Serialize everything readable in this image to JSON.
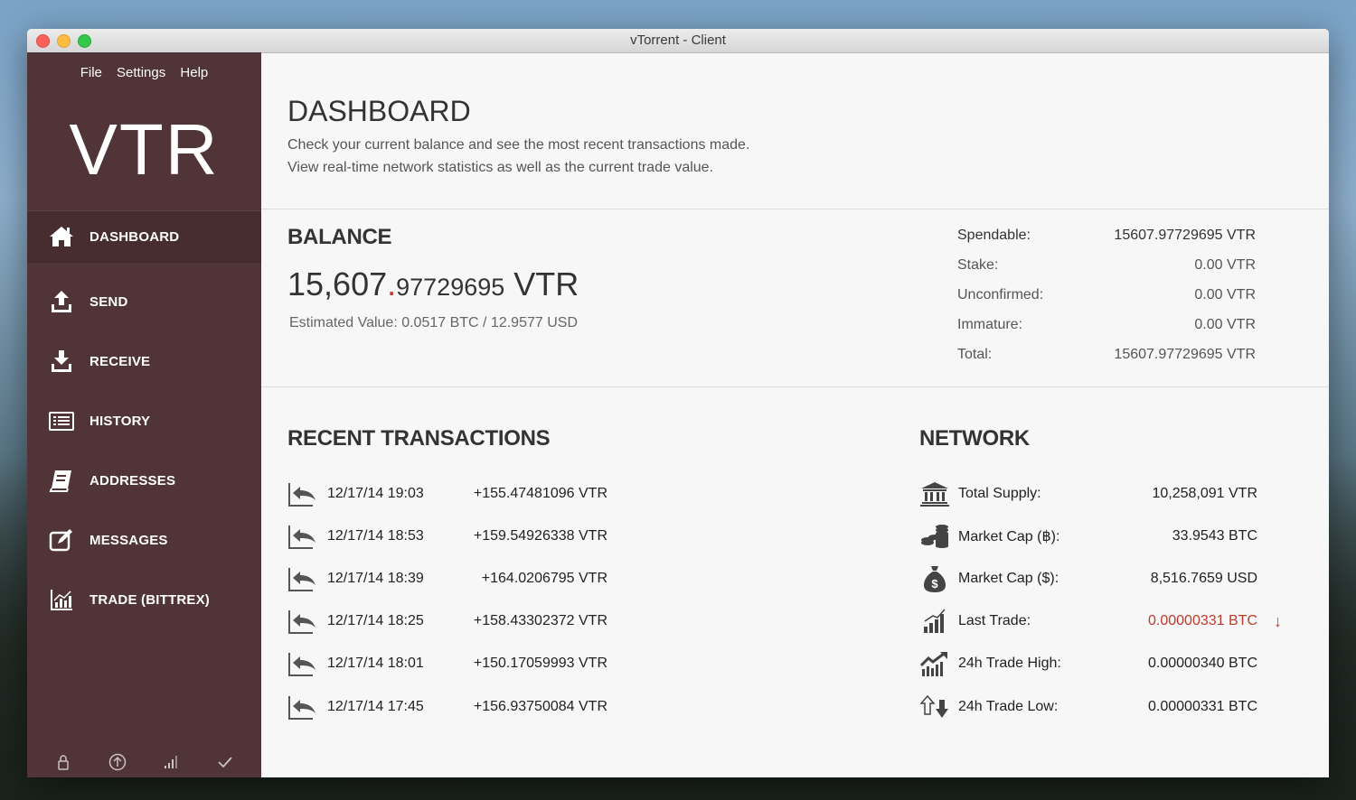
{
  "window": {
    "title": "vTorrent - Client"
  },
  "menu": {
    "file": "File",
    "settings": "Settings",
    "help": "Help"
  },
  "logo": "VTR",
  "nav": [
    {
      "label": "DASHBOARD",
      "icon": "home-icon"
    },
    {
      "label": "SEND",
      "icon": "upload-icon"
    },
    {
      "label": "RECEIVE",
      "icon": "download-icon"
    },
    {
      "label": "HISTORY",
      "icon": "list-icon"
    },
    {
      "label": "ADDRESSES",
      "icon": "address-book-icon"
    },
    {
      "label": "MESSAGES",
      "icon": "edit-message-icon"
    },
    {
      "label": "TRADE (BITTREX)",
      "icon": "chart-icon"
    }
  ],
  "footer_icons": [
    "lock-icon",
    "upload-circle-icon",
    "signal-icon",
    "check-icon"
  ],
  "header": {
    "title": "DASHBOARD",
    "line1": "Check your current balance and see the most recent transactions made.",
    "line2": "View real-time network statistics as well as the current trade value."
  },
  "balance": {
    "title": "BALANCE",
    "amount_int": "15,607",
    "amount_dot": ".",
    "amount_frac": "97729695",
    "amount_unit": "VTR",
    "estimate": "Estimated Value: 0.0517 BTC / 12.9577 USD",
    "stats": [
      {
        "label": "Spendable:",
        "value": "15607.97729695 VTR"
      },
      {
        "label": "Stake:",
        "value": "0.00 VTR"
      },
      {
        "label": "Unconfirmed:",
        "value": "0.00 VTR"
      },
      {
        "label": "Immature:",
        "value": "0.00 VTR"
      },
      {
        "label": "Total:",
        "value": "15607.97729695 VTR"
      }
    ]
  },
  "transactions": {
    "title": "RECENT TRANSACTIONS",
    "items": [
      {
        "date": "12/17/14 19:03",
        "amount": "+155.47481096 VTR"
      },
      {
        "date": "12/17/14 18:53",
        "amount": "+159.54926338 VTR"
      },
      {
        "date": "12/17/14 18:39",
        "amount": "+164.0206795 VTR"
      },
      {
        "date": "12/17/14 18:25",
        "amount": "+158.43302372 VTR"
      },
      {
        "date": "12/17/14 18:01",
        "amount": "+150.17059993 VTR"
      },
      {
        "date": "12/17/14 17:45",
        "amount": "+156.93750084 VTR"
      }
    ]
  },
  "network": {
    "title": "NETWORK",
    "items": [
      {
        "label": "Total Supply:",
        "value": "10,258,091 VTR",
        "icon": "bank-icon"
      },
      {
        "label": "Market Cap (฿):",
        "value": "33.9543 BTC",
        "icon": "coins-icon"
      },
      {
        "label": "Market Cap ($):",
        "value": "8,516.7659 USD",
        "icon": "money-bag-icon"
      },
      {
        "label": "Last Trade:",
        "value": "0.00000331 BTC",
        "icon": "bar-chart-icon",
        "trend": "↓"
      },
      {
        "label": "24h Trade High:",
        "value": "0.00000340 BTC",
        "icon": "trend-up-icon"
      },
      {
        "label": "24h Trade Low:",
        "value": "0.00000331 BTC",
        "icon": "up-down-arrows-icon"
      }
    ]
  },
  "colors": {
    "sidebar": "#503437",
    "sidebar_active": "#472d30",
    "accent_red": "#c0392b"
  }
}
